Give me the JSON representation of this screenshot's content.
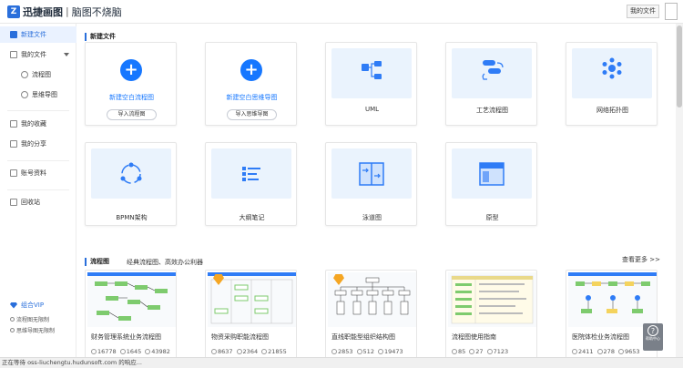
{
  "header": {
    "logo_mark": "Z",
    "app_name": "迅捷画图",
    "separator": "|",
    "slogan": "脑图不烧脑",
    "my_docs_button": "我的文件"
  },
  "sidebar": {
    "new_file": "新建文件",
    "my_files": "我的文件",
    "flowchart": "流程图",
    "mindmap": "思维导图",
    "favorites": "我的收藏",
    "shares": "我的分享",
    "account": "账号资料",
    "recycle": "回收站",
    "vip": "组合VIP",
    "flow_limit": "流程图无限制",
    "mind_limit": "思维导图无限制"
  },
  "new_section": {
    "title": "新建文件",
    "cards": [
      {
        "label": "新建空白流程图",
        "button": "导入流程图"
      },
      {
        "label": "新建空白思维导图",
        "button": "导入思维导图"
      },
      {
        "label": "UML",
        "icon": "uml-icon"
      },
      {
        "label": "工艺流程图",
        "icon": "process-icon"
      },
      {
        "label": "网络拓扑图",
        "icon": "network-icon"
      },
      {
        "label": "BPMN架构",
        "icon": "bpmn-icon"
      },
      {
        "label": "大纲笔记",
        "icon": "outline-icon"
      },
      {
        "label": "泳道图",
        "icon": "swimlane-icon"
      },
      {
        "label": "原型",
        "icon": "prototype-icon"
      }
    ],
    "plus": "+"
  },
  "templates": {
    "title": "流程图",
    "subtitle": "经典流程图、高效办公利器",
    "more": "查看更多 >>",
    "items": [
      {
        "name": "财务管理系统业务流程图",
        "views": "16778",
        "likes": "1645",
        "uses": "43982"
      },
      {
        "name": "物资采购职能流程图",
        "views": "8637",
        "likes": "2364",
        "uses": "21855"
      },
      {
        "name": "直线职能型组织结构图",
        "views": "2853",
        "likes": "512",
        "uses": "19473"
      },
      {
        "name": "流程图使用指南",
        "views": "85",
        "likes": "27",
        "uses": "7123"
      },
      {
        "name": "医院体检业务流程图",
        "views": "2411",
        "likes": "278",
        "uses": "9653"
      }
    ]
  },
  "help": {
    "label": "帮助中心",
    "q": "?"
  },
  "status": "正在等待 oss-liuchengtu.hudunsoft.com 的响应...",
  "colors": {
    "accent": "#1677ff",
    "thumb_bg": "#eaf3fd"
  }
}
